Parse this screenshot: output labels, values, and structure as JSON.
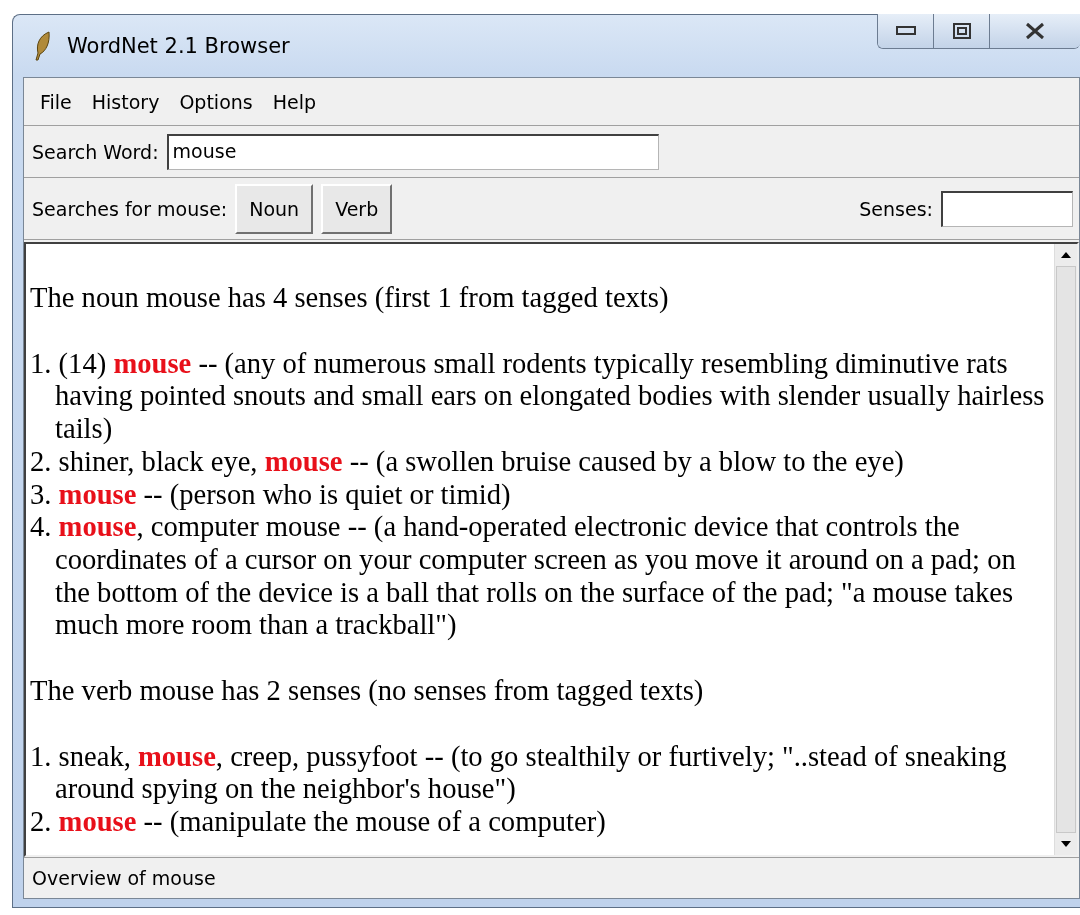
{
  "window": {
    "title": "WordNet 2.1 Browser"
  },
  "menu": [
    "File",
    "History",
    "Options",
    "Help"
  ],
  "search": {
    "label": "Search Word:",
    "value": "mouse"
  },
  "searches": {
    "label": "Searches for mouse:",
    "buttons": [
      "Noun",
      "Verb"
    ],
    "senses_label": "Senses:"
  },
  "results": [
    {
      "heading": "The noun mouse has 4 senses (first 1 from tagged texts)",
      "senses": [
        "1. (14) **mouse** -- (any of numerous small rodents typically resembling diminutive rats having pointed snouts and small ears on elongated bodies with slender usually hairless tails)",
        "2. shiner, black eye, **mouse** -- (a swollen bruise caused by a blow to the eye)",
        "3. **mouse** -- (person who is quiet or timid)",
        "4. **mouse**, computer mouse -- (a hand-operated electronic device that controls the coordinates of a cursor on your computer screen as you move it around on a pad; on the bottom of the device is a ball that rolls on the surface of the pad; \"a mouse takes much more room than a trackball\")"
      ]
    },
    {
      "heading": "The verb mouse has 2 senses (no senses from tagged texts)",
      "senses": [
        "1. sneak, **mouse**, creep, pussyfoot -- (to go stealthily or furtively; \"..stead of sneaking around spying on the neighbor's house\")",
        "2. **mouse** -- (manipulate the mouse of a computer)"
      ]
    }
  ],
  "status_bar": "Overview of mouse"
}
